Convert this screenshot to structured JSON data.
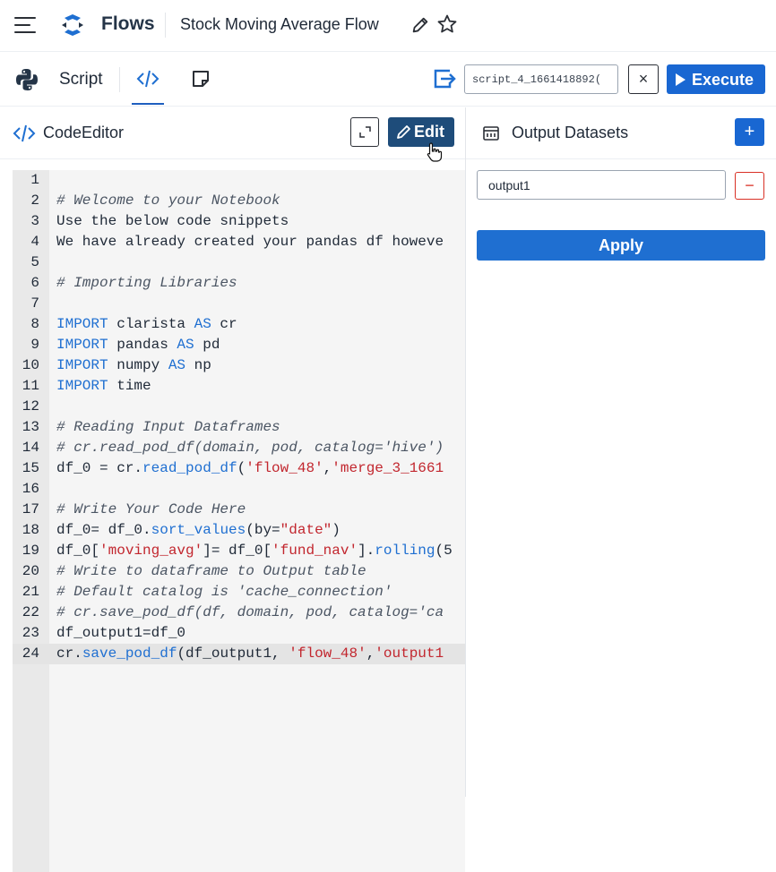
{
  "header": {
    "app_name": "Flows",
    "flow_name": "Stock Moving Average Flow",
    "icons": [
      "hamburger-menu-icon",
      "app-logo-icon",
      "pencil-icon",
      "star-icon"
    ]
  },
  "toolbar": {
    "script_label": "Script",
    "script_name_value": "script_4_1661418892(",
    "clear_label": "×",
    "execute_label": "Execute",
    "icons": [
      "python-icon",
      "code-icon",
      "note-icon",
      "export-icon",
      "play-icon"
    ]
  },
  "editor": {
    "title": "CodeEditor",
    "edit_label": "Edit",
    "lines": [
      {
        "n": "1",
        "segs": []
      },
      {
        "n": "2",
        "segs": [
          {
            "t": "# Welcome to your Notebook",
            "c": "comment"
          }
        ]
      },
      {
        "n": "3",
        "segs": [
          {
            "t": "Use the below code snippets",
            "c": "plain"
          }
        ]
      },
      {
        "n": "4",
        "segs": [
          {
            "t": "We have already created your pandas df howeve",
            "c": "plain"
          }
        ]
      },
      {
        "n": "5",
        "segs": []
      },
      {
        "n": "6",
        "segs": [
          {
            "t": "# Importing Libraries",
            "c": "comment"
          }
        ]
      },
      {
        "n": "7",
        "segs": []
      },
      {
        "n": "8",
        "segs": [
          {
            "t": "IMPORT",
            "c": "kw"
          },
          {
            "t": " clarista ",
            "c": "plain"
          },
          {
            "t": "AS",
            "c": "kw"
          },
          {
            "t": " cr",
            "c": "plain"
          }
        ]
      },
      {
        "n": "9",
        "segs": [
          {
            "t": "IMPORT",
            "c": "kw"
          },
          {
            "t": " pandas ",
            "c": "plain"
          },
          {
            "t": "AS",
            "c": "kw"
          },
          {
            "t": " pd",
            "c": "plain"
          }
        ]
      },
      {
        "n": "10",
        "segs": [
          {
            "t": "IMPORT",
            "c": "kw"
          },
          {
            "t": " numpy ",
            "c": "plain"
          },
          {
            "t": "AS",
            "c": "kw"
          },
          {
            "t": " np",
            "c": "plain"
          }
        ]
      },
      {
        "n": "11",
        "segs": [
          {
            "t": "IMPORT",
            "c": "kw"
          },
          {
            "t": " time",
            "c": "plain"
          }
        ]
      },
      {
        "n": "12",
        "segs": []
      },
      {
        "n": "13",
        "segs": [
          {
            "t": "# Reading Input Dataframes",
            "c": "comment"
          }
        ]
      },
      {
        "n": "14",
        "segs": [
          {
            "t": "# cr.read_pod_df(domain, pod, catalog='hive')",
            "c": "comment"
          }
        ]
      },
      {
        "n": "15",
        "segs": [
          {
            "t": "df_0 = cr.",
            "c": "plain"
          },
          {
            "t": "read_pod_df",
            "c": "fn"
          },
          {
            "t": "(",
            "c": "plain"
          },
          {
            "t": "'flow_48'",
            "c": "str"
          },
          {
            "t": ",",
            "c": "plain"
          },
          {
            "t": "'merge_3_1661",
            "c": "str"
          }
        ]
      },
      {
        "n": "16",
        "segs": []
      },
      {
        "n": "17",
        "segs": [
          {
            "t": "# Write Your Code Here",
            "c": "comment"
          }
        ]
      },
      {
        "n": "18",
        "segs": [
          {
            "t": "df_0= df_0.",
            "c": "plain"
          },
          {
            "t": "sort_values",
            "c": "fn"
          },
          {
            "t": "(by=",
            "c": "plain"
          },
          {
            "t": "\"date\"",
            "c": "str"
          },
          {
            "t": ")",
            "c": "plain"
          }
        ]
      },
      {
        "n": "19",
        "segs": [
          {
            "t": "df_0[",
            "c": "plain"
          },
          {
            "t": "'moving_avg'",
            "c": "str"
          },
          {
            "t": "]= df_0[",
            "c": "plain"
          },
          {
            "t": "'fund_nav'",
            "c": "str"
          },
          {
            "t": "].",
            "c": "plain"
          },
          {
            "t": "rolling",
            "c": "fn"
          },
          {
            "t": "(5",
            "c": "plain"
          }
        ]
      },
      {
        "n": "20",
        "segs": [
          {
            "t": "# Write to dataframe to Output table",
            "c": "comment"
          }
        ]
      },
      {
        "n": "21",
        "segs": [
          {
            "t": "# Default catalog is 'cache_connection'",
            "c": "comment"
          }
        ]
      },
      {
        "n": "22",
        "segs": [
          {
            "t": "# cr.save_pod_df(df, domain, pod, catalog='ca",
            "c": "comment"
          }
        ]
      },
      {
        "n": "23",
        "segs": [
          {
            "t": "df_output1=df_0",
            "c": "plain"
          }
        ]
      },
      {
        "n": "24",
        "segs": [
          {
            "t": "cr.",
            "c": "plain"
          },
          {
            "t": "save_pod_df",
            "c": "fn"
          },
          {
            "t": "(df_output1, ",
            "c": "plain"
          },
          {
            "t": "'flow_48'",
            "c": "str"
          },
          {
            "t": ",",
            "c": "plain"
          },
          {
            "t": "'output1",
            "c": "str"
          }
        ]
      }
    ],
    "active_line": "24"
  },
  "output": {
    "title": "Output Datasets",
    "add_label": "+",
    "dataset_value": "output1",
    "remove_label": "−",
    "apply_label": "Apply"
  },
  "colors": {
    "primary": "#1967d2",
    "edit_button": "#1e4c7a",
    "keyword": "#1f6fd1",
    "string": "#c2262e",
    "danger": "#d93025"
  }
}
